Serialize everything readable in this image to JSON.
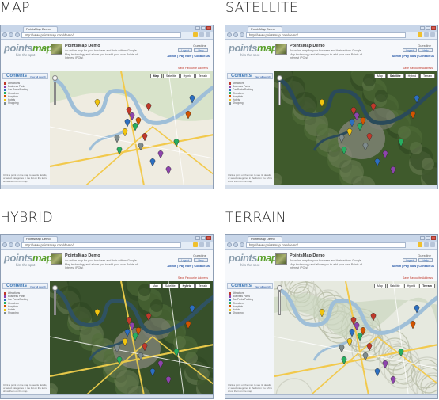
{
  "panels": [
    {
      "id": "map",
      "label": "MAP",
      "map_type": "map",
      "active_tab": "Map",
      "bg": "#e8e4d8"
    },
    {
      "id": "satellite",
      "label": "SATELLITE",
      "map_type": "satellite",
      "active_tab": "Satellite",
      "bg": "#3f5a2c"
    },
    {
      "id": "hybrid",
      "label": "HYBRID",
      "map_type": "hybrid",
      "active_tab": "Hybrid",
      "bg": "#37502a"
    },
    {
      "id": "terrain",
      "label": "TERRAIN",
      "map_type": "terrain",
      "active_tab": "Terrain",
      "bg": "#e6e9df"
    }
  ],
  "browser": {
    "tab_label": "PointsMap Demo",
    "address": "http://www.pointsmap.com/demo/"
  },
  "app": {
    "logo_main": "points",
    "logo_accent": "map",
    "logo_tagline": "hits the spot",
    "demo_title": "PointsMap Demo",
    "demo_desc": "An online map for your business and their editors Google Map technology and allows you to add your own Points of Interest (POIs)",
    "user_label": "Guestline",
    "login_buttons": [
      "Logout",
      "Help"
    ],
    "links": "Admin | Pay Now | Contact us",
    "favourite_link": "Save Favourite Address",
    "contents_label": "Contents",
    "contents_links": "View all  search",
    "legend": [
      {
        "label": "Attractions",
        "color": "#c0392b"
      },
      {
        "label": "Business Parks",
        "color": "#8e44ad"
      },
      {
        "label": "Car Parks/Parking",
        "color": "#2c6fc1"
      },
      {
        "label": "Churches",
        "color": "#27ae60"
      },
      {
        "label": "Hospitals",
        "color": "#d35400"
      },
      {
        "label": "Hotels",
        "color": "#f1c40f"
      },
      {
        "label": "Shopping",
        "color": "#7f8c8d"
      }
    ],
    "footer_text": "Click a point on the map to see its details, or select categories in the list on the left to show them on the map.",
    "map_type_buttons": [
      "Map",
      "Satellite",
      "Hybrid",
      "Terrain"
    ]
  }
}
